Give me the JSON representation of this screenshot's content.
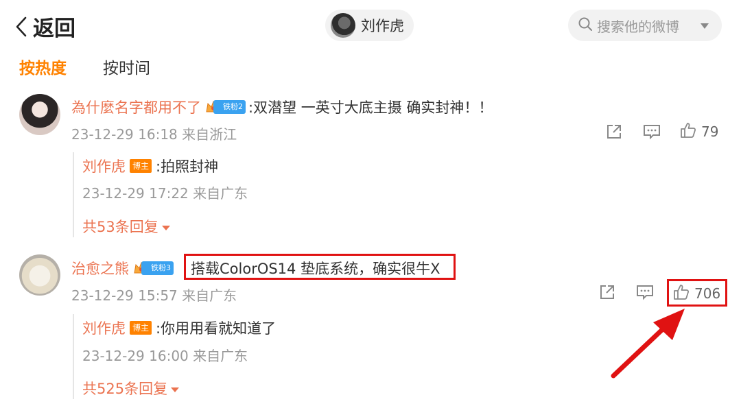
{
  "header": {
    "back_label": "返回",
    "profile_name": "刘作虎",
    "search_placeholder": "搜索他的微博"
  },
  "sort_tabs": [
    {
      "label": "按热度",
      "active": true
    },
    {
      "label": "按时间",
      "active": false
    }
  ],
  "comments": [
    {
      "user": "為什麼名字都用不了",
      "fan_badge": "铁粉2",
      "text": ":双潜望 一英寸大底主摄 确实封神！！",
      "meta": "23-12-29 16:18 来自浙江",
      "likes": "79",
      "reply": {
        "user": "刘作虎",
        "badge": "博主",
        "text": ":拍照封神",
        "meta": "23-12-29 17:22 来自广东"
      },
      "more_replies": "共53条回复"
    },
    {
      "user": "治愈之熊",
      "fan_badge": "铁粉3",
      "text": "搭载ColorOS14 垫底系统，确实很牛X",
      "meta": "23-12-29 15:57 来自广东",
      "likes": "706",
      "reply": {
        "user": "刘作虎",
        "badge": "博主",
        "text": ":你用用看就知道了",
        "meta": "23-12-29 16:00 来自广东"
      },
      "more_replies": "共525条回复"
    }
  ],
  "colors": {
    "accent": "#ff8200",
    "username": "#eb7350",
    "highlight": "#e01212",
    "meta": "#999999"
  }
}
